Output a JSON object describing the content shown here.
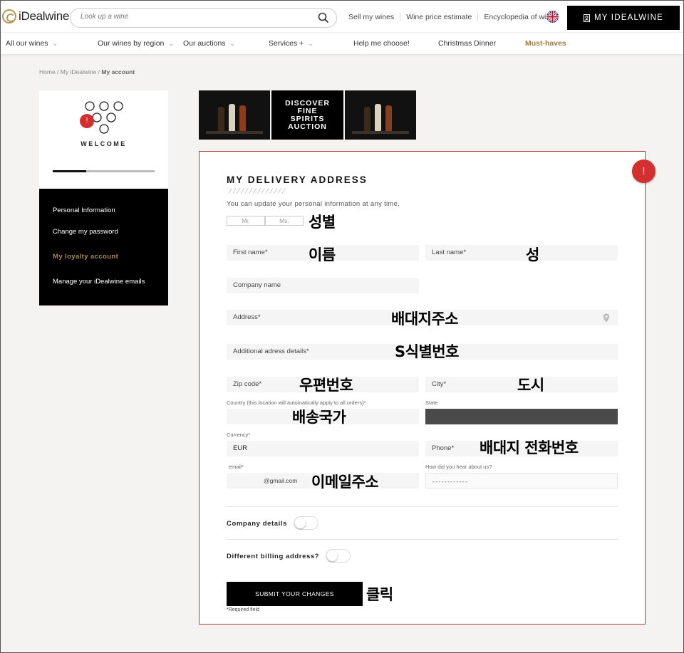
{
  "header": {
    "logo_text": "iDealwine",
    "search_placeholder": "Look up a wine",
    "links": [
      "Sell my wines",
      "Wine price estimate",
      "Encyclopedia of wine"
    ],
    "account_button": "MY IDEALWINE"
  },
  "nav": {
    "items": [
      {
        "label": "All our wines"
      },
      {
        "label": "Our wines by region"
      },
      {
        "label": "Our auctions"
      },
      {
        "label": "Services +"
      },
      {
        "label": "Help me choose!"
      },
      {
        "label": "Christmas Dinner"
      },
      {
        "label": "Must-haves"
      }
    ]
  },
  "breadcrumb": {
    "home": "Home",
    "mid": "My iDealwine",
    "current": "My account"
  },
  "sidebar": {
    "welcome": "WELCOME",
    "profile_progress": 0.33,
    "items": [
      {
        "label": "Personal Information"
      },
      {
        "label": "Change my password"
      },
      {
        "label": "My loyalty account"
      },
      {
        "label": "Manage your iDealwine emails"
      }
    ],
    "badge": "!"
  },
  "banner": {
    "line1": "DISCOVER",
    "line2": "FINE",
    "line3": "SPIRITS",
    "line4": "AUCTION"
  },
  "form": {
    "alert": "!",
    "title": "MY DELIVERY ADDRESS",
    "subtitle": "You can update your personal information at any time.",
    "gender": [
      "Mr.",
      "Ms."
    ],
    "first_name": "First name*",
    "last_name": "Last name*",
    "company": "Company name",
    "address": "Address*",
    "address_details": "Additional adress details*",
    "zip": "Zip code*",
    "city": "City*",
    "country_label": "Country (this location will automatically apply to all orders)*",
    "state_label": "State",
    "currency_label": "Currency*",
    "currency_value": "EUR",
    "phone": "Phone*",
    "email_label": "email*",
    "email_value": "@gmail.com",
    "hear_label": "How did you hear about us?",
    "hear_value": "- - - - - - - - - - - -",
    "company_details": "Company details",
    "billing": "Different billing address?",
    "submit": "SUBMIT YOUR CHANGES",
    "required": "*Required field"
  },
  "annotations": {
    "gender": "성별",
    "first_name": "이름",
    "last_name": "성",
    "address": "배대지주소",
    "address_details": "S식별번호",
    "zip": "우편번호",
    "city": "도시",
    "country": "배송국가",
    "phone": "배대지 전화번호",
    "email": "이메일주소",
    "click": "클릭"
  },
  "colors": {
    "brand_gold": "#b9975b",
    "alert_red": "#d32f2f",
    "card_border": "#b23a3a"
  }
}
